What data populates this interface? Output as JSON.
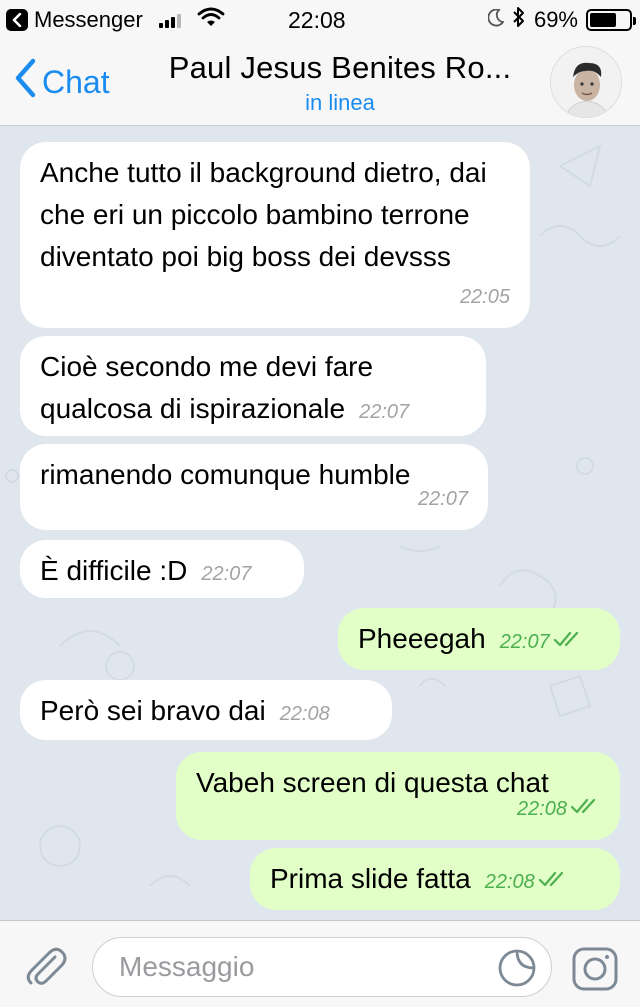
{
  "status_bar": {
    "app_back_label": "Messenger",
    "time": "22:08",
    "battery": "69%",
    "battery_level": 0.69
  },
  "nav": {
    "back_label": "Chat",
    "title": "Paul Jesus Benites Ro...",
    "subtitle": "in linea"
  },
  "messages": [
    {
      "dir": "in",
      "text": "Anche tutto il background dietro, dai che eri un piccolo bambino terrone diventato poi big boss dei devsss",
      "time": "22:05"
    },
    {
      "dir": "in",
      "text": "Cioè secondo me devi fare qualcosa di ispirazionale",
      "time": "22:07"
    },
    {
      "dir": "in",
      "text": "rimanendo comunque humble",
      "time": "22:07"
    },
    {
      "dir": "in",
      "text": "È difficile :D",
      "time": "22:07"
    },
    {
      "dir": "out",
      "text": "Pheeegah",
      "time": "22:07",
      "read": true
    },
    {
      "dir": "in",
      "text": "Però sei bravo dai",
      "time": "22:08"
    },
    {
      "dir": "out",
      "text": "Vabeh screen di questa chat",
      "time": "22:08",
      "read": true
    },
    {
      "dir": "out",
      "text": "Prima slide fatta",
      "time": "22:08",
      "read": true
    }
  ],
  "input": {
    "placeholder": "Messaggio"
  },
  "colors": {
    "accent": "#1a8cf0",
    "incoming_bubble": "#ffffff",
    "outgoing_bubble": "#e1ffc7",
    "read_check": "#4caf50"
  },
  "icons": {
    "app_back": "chevron-left-icon",
    "back": "chevron-left-icon",
    "attach": "paperclip-icon",
    "sticker": "sticker-icon",
    "camera": "camera-icon",
    "read": "double-check-icon"
  }
}
